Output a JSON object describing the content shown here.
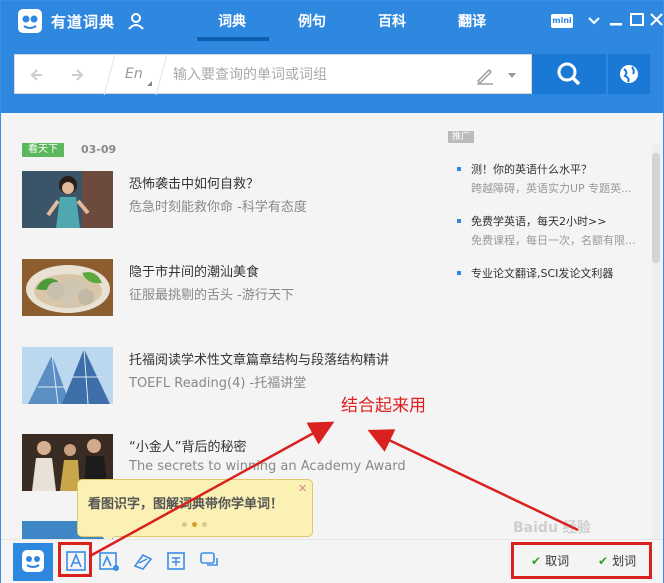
{
  "app": {
    "title": "有道词典",
    "tabs": [
      "词典",
      "例句",
      "百科",
      "翻译"
    ],
    "mini_label": "mini"
  },
  "search": {
    "lang": "En",
    "placeholder": "输入要查询的单词或词组"
  },
  "feed": {
    "badge": "看天下",
    "date": "03-09",
    "items": [
      {
        "title": "恐怖袭击中如何自救？",
        "subtitle": "危急时刻能救你命 -科学有态度"
      },
      {
        "title": "隐于市井间的潮汕美食",
        "subtitle": "征服最挑剔的舌头 -游行天下"
      },
      {
        "title": "托福阅读学术性文章篇章结构与段落结构精讲",
        "subtitle": "TOEFL Reading(4) -托福讲堂"
      },
      {
        "title": "“小金人”背后的秘密",
        "subtitle": "The secrets to winning an Academy Award"
      }
    ]
  },
  "ads": {
    "tag": "推广",
    "items": [
      {
        "title": "测！你的英语什么水平？",
        "subtitle": "跨越障碍，英语实力UP 专题英..."
      },
      {
        "title": "免费学英语，每天2小时>>",
        "subtitle": "免费课程，每日一次，名额有限..."
      },
      {
        "title": "专业论文翻译,SCI发论文利器",
        "subtitle": ""
      }
    ]
  },
  "annotation": "结合起来用",
  "tooltip": {
    "text": "看图识字，图解词典带你学单词！",
    "close": "✕"
  },
  "bottom": {
    "toggle_quci": "取词",
    "toggle_huaci": "划词",
    "watermark": "Baidu 经验"
  }
}
